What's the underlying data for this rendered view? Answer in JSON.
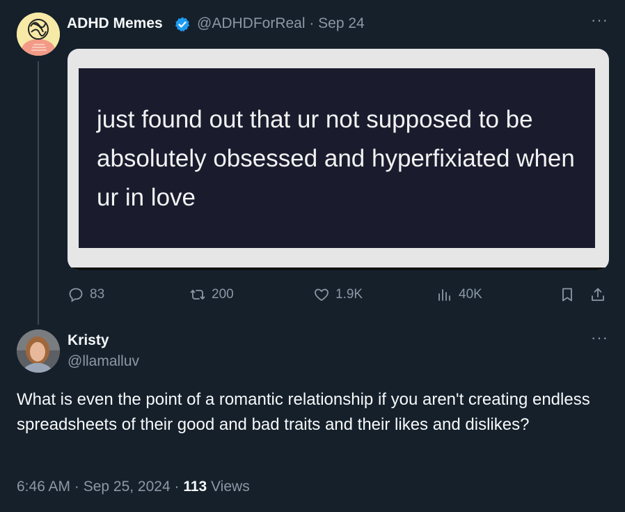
{
  "tweet1": {
    "display_name": "ADHD Memes",
    "handle_date": "@ADHDForReal · Sep 24",
    "media_text": "just found out that ur not supposed to be absolutely obsessed and hyperfixiated when  ur in love",
    "actions": {
      "replies": "83",
      "retweets": "200",
      "likes": "1.9K",
      "views": "40K"
    }
  },
  "tweet2": {
    "display_name": "Kristy",
    "handle": "@llamalluv",
    "text": "What is even the point of a romantic relationship if you aren't creating endless spreadsheets of their good and bad traits and their likes and dislikes?",
    "time": "6:46 AM · Sep 25, 2024 · ",
    "views_count": "113",
    "views_label": " Views"
  },
  "more_label": "···",
  "colors": {
    "background": "#15202b",
    "secondary": "#8b98a5",
    "verified": "#1d9bf0"
  }
}
